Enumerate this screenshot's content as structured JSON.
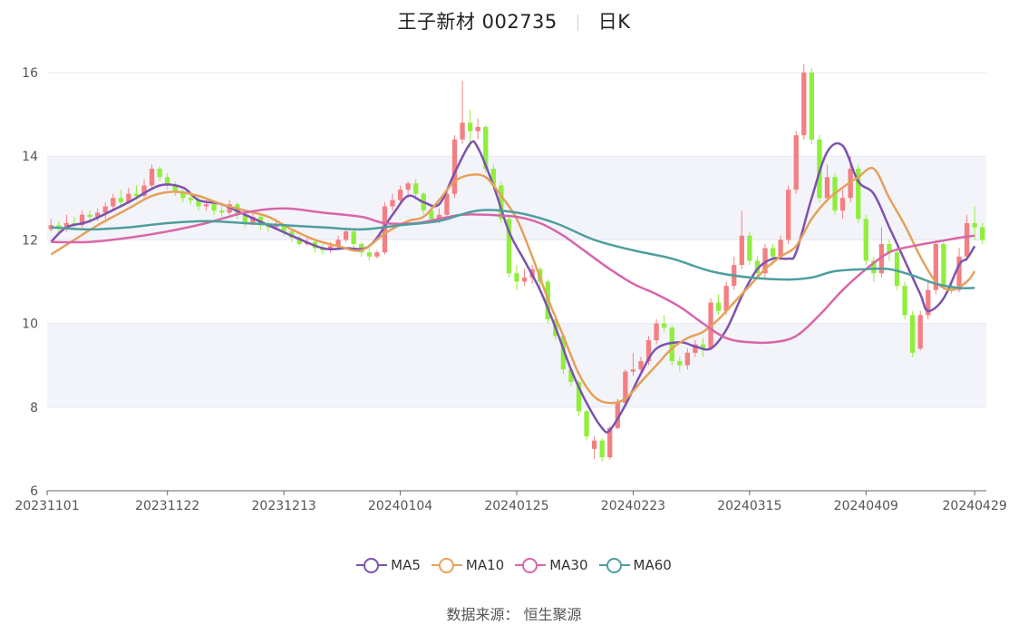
{
  "header": {
    "title": "王子新材 002735",
    "period": "日K"
  },
  "source": {
    "label": "数据来源：",
    "name": "恒生聚源"
  },
  "colors": {
    "up": "#f47f82",
    "down": "#90ee3c",
    "MA5": "#7b52b0",
    "MA10": "#e6a05a",
    "MA30": "#d966a8",
    "MA60": "#4f9e9e",
    "band": "#f3f4fa",
    "grid": "#e4e7f2"
  },
  "chart_data": {
    "type": "candlestick",
    "ylim": [
      6,
      16
    ],
    "y_ticks": [
      6,
      8,
      10,
      12,
      14,
      16
    ],
    "x_ticks": [
      "20231101",
      "20231122",
      "20231213",
      "20240104",
      "20240125",
      "20240223",
      "20240315",
      "20240409",
      "20240429"
    ],
    "x_tick_index": [
      0,
      15,
      30,
      45,
      60,
      75,
      90,
      105,
      119
    ],
    "legend": [
      "MA5",
      "MA10",
      "MA30",
      "MA60"
    ],
    "legend_position": "bottom",
    "grid": true,
    "candles": [
      [
        12.25,
        12.35,
        12.5,
        12.2
      ],
      [
        12.35,
        12.3,
        12.45,
        12.15
      ],
      [
        12.3,
        12.4,
        12.6,
        12.2
      ],
      [
        12.4,
        12.35,
        12.55,
        12.25
      ],
      [
        12.35,
        12.6,
        12.7,
        12.3
      ],
      [
        12.6,
        12.55,
        12.7,
        12.4
      ],
      [
        12.55,
        12.65,
        12.75,
        12.45
      ],
      [
        12.65,
        12.8,
        12.9,
        12.5
      ],
      [
        12.8,
        13.0,
        13.1,
        12.7
      ],
      [
        13.0,
        12.9,
        13.2,
        12.8
      ],
      [
        12.9,
        13.1,
        13.25,
        12.85
      ],
      [
        13.1,
        13.05,
        13.3,
        12.95
      ],
      [
        13.05,
        13.3,
        13.45,
        13.0
      ],
      [
        13.3,
        13.7,
        13.8,
        13.2
      ],
      [
        13.7,
        13.5,
        13.75,
        13.4
      ],
      [
        13.5,
        13.3,
        13.6,
        13.2
      ],
      [
        13.3,
        13.15,
        13.4,
        13.05
      ],
      [
        13.15,
        13.0,
        13.2,
        12.9
      ],
      [
        13.0,
        12.95,
        13.1,
        12.85
      ],
      [
        12.95,
        12.8,
        13.05,
        12.7
      ],
      [
        12.8,
        12.85,
        13.0,
        12.7
      ],
      [
        12.85,
        12.7,
        12.95,
        12.6
      ],
      [
        12.7,
        12.65,
        12.85,
        12.55
      ],
      [
        12.65,
        12.85,
        12.95,
        12.6
      ],
      [
        12.85,
        12.6,
        12.9,
        12.5
      ],
      [
        12.6,
        12.4,
        12.7,
        12.3
      ],
      [
        12.4,
        12.55,
        12.65,
        12.35
      ],
      [
        12.55,
        12.35,
        12.6,
        12.25
      ],
      [
        12.35,
        12.3,
        12.45,
        12.2
      ],
      [
        12.3,
        12.35,
        12.5,
        12.25
      ],
      [
        12.35,
        12.2,
        12.4,
        12.1
      ],
      [
        12.2,
        12.05,
        12.25,
        11.95
      ],
      [
        12.05,
        11.9,
        12.1,
        11.85
      ],
      [
        11.9,
        11.95,
        12.05,
        11.85
      ],
      [
        11.95,
        11.8,
        12.0,
        11.7
      ],
      [
        11.8,
        11.75,
        11.9,
        11.65
      ],
      [
        11.75,
        11.85,
        11.95,
        11.7
      ],
      [
        11.85,
        12.0,
        12.1,
        11.8
      ],
      [
        12.0,
        12.2,
        12.3,
        11.95
      ],
      [
        12.2,
        11.9,
        12.25,
        11.8
      ],
      [
        11.9,
        11.7,
        11.95,
        11.6
      ],
      [
        11.7,
        11.6,
        11.8,
        11.5
      ],
      [
        11.6,
        11.7,
        11.75,
        11.55
      ],
      [
        11.7,
        12.8,
        12.9,
        11.65
      ],
      [
        12.8,
        12.95,
        13.1,
        12.7
      ],
      [
        12.95,
        13.2,
        13.3,
        12.85
      ],
      [
        13.2,
        13.35,
        13.4,
        13.0
      ],
      [
        13.35,
        13.1,
        13.45,
        12.95
      ],
      [
        13.1,
        12.7,
        13.15,
        12.6
      ],
      [
        12.7,
        12.5,
        12.8,
        12.4
      ],
      [
        12.5,
        12.6,
        12.75,
        12.4
      ],
      [
        12.6,
        13.1,
        13.2,
        12.55
      ],
      [
        13.1,
        14.4,
        14.5,
        13.0
      ],
      [
        14.4,
        14.8,
        15.8,
        14.3
      ],
      [
        14.8,
        14.6,
        15.1,
        14.2
      ],
      [
        14.6,
        14.7,
        14.9,
        14.4
      ],
      [
        14.7,
        13.7,
        14.75,
        13.6
      ],
      [
        13.7,
        13.3,
        13.8,
        13.2
      ],
      [
        13.3,
        12.5,
        13.4,
        12.4
      ],
      [
        12.5,
        11.2,
        12.55,
        11.1
      ],
      [
        11.2,
        11.0,
        11.4,
        10.8
      ],
      [
        11.0,
        11.1,
        11.3,
        10.9
      ],
      [
        11.1,
        11.3,
        11.4,
        10.95
      ],
      [
        11.3,
        11.0,
        11.35,
        10.8
      ],
      [
        11.0,
        10.1,
        11.05,
        10.0
      ],
      [
        10.1,
        9.7,
        10.15,
        9.6
      ],
      [
        9.7,
        8.9,
        9.75,
        8.8
      ],
      [
        8.9,
        8.6,
        8.95,
        8.5
      ],
      [
        8.6,
        7.9,
        8.65,
        7.8
      ],
      [
        7.9,
        7.3,
        7.95,
        7.2
      ],
      [
        7.0,
        7.2,
        7.3,
        6.75
      ],
      [
        7.2,
        6.8,
        7.25,
        6.7
      ],
      [
        6.8,
        7.5,
        7.55,
        6.75
      ],
      [
        7.5,
        8.1,
        8.2,
        7.45
      ],
      [
        8.1,
        8.85,
        8.9,
        8.0
      ],
      [
        8.85,
        8.9,
        9.3,
        8.75
      ],
      [
        8.9,
        9.1,
        9.2,
        8.8
      ],
      [
        9.1,
        9.6,
        9.7,
        9.0
      ],
      [
        9.6,
        10.0,
        10.1,
        9.5
      ],
      [
        10.0,
        9.9,
        10.2,
        9.8
      ],
      [
        9.9,
        9.1,
        9.95,
        9.0
      ],
      [
        9.1,
        9.0,
        9.2,
        8.85
      ],
      [
        9.0,
        9.3,
        9.4,
        8.9
      ],
      [
        9.3,
        9.5,
        9.6,
        9.2
      ],
      [
        9.5,
        9.4,
        9.65,
        9.2
      ],
      [
        9.4,
        10.5,
        10.6,
        9.35
      ],
      [
        10.5,
        10.3,
        10.7,
        10.2
      ],
      [
        10.3,
        10.9,
        11.0,
        10.2
      ],
      [
        10.9,
        11.4,
        11.6,
        10.8
      ],
      [
        11.4,
        12.1,
        12.7,
        11.3
      ],
      [
        12.1,
        11.5,
        12.2,
        11.4
      ],
      [
        11.5,
        11.2,
        11.6,
        11.1
      ],
      [
        11.2,
        11.8,
        11.9,
        11.1
      ],
      [
        11.8,
        11.6,
        11.9,
        11.4
      ],
      [
        11.6,
        12.0,
        12.1,
        11.5
      ],
      [
        12.0,
        13.2,
        13.3,
        11.9
      ],
      [
        13.2,
        14.5,
        14.6,
        13.1
      ],
      [
        14.5,
        16.0,
        16.2,
        14.4
      ],
      [
        16.0,
        14.4,
        16.1,
        14.3
      ],
      [
        14.4,
        13.0,
        14.5,
        12.9
      ],
      [
        13.0,
        13.5,
        13.8,
        12.9
      ],
      [
        13.5,
        12.7,
        13.6,
        12.6
      ],
      [
        12.7,
        13.0,
        13.2,
        12.5
      ],
      [
        13.0,
        13.7,
        14.0,
        12.9
      ],
      [
        13.7,
        12.5,
        13.8,
        12.4
      ],
      [
        12.5,
        11.5,
        12.6,
        11.4
      ],
      [
        11.5,
        11.2,
        11.6,
        11.0
      ],
      [
        11.2,
        11.9,
        12.3,
        11.1
      ],
      [
        11.9,
        11.7,
        12.0,
        11.5
      ],
      [
        11.7,
        10.9,
        11.8,
        10.8
      ],
      [
        10.9,
        10.2,
        11.0,
        10.1
      ],
      [
        10.2,
        9.3,
        10.3,
        9.2
      ],
      [
        9.4,
        10.2,
        10.3,
        9.35
      ],
      [
        10.2,
        10.8,
        11.0,
        10.1
      ],
      [
        10.8,
        11.9,
        12.0,
        10.7
      ],
      [
        11.9,
        10.9,
        11.95,
        10.8
      ],
      [
        10.9,
        10.8,
        11.0,
        10.7
      ],
      [
        10.8,
        11.6,
        11.8,
        10.75
      ],
      [
        11.6,
        12.4,
        12.6,
        11.5
      ],
      [
        12.4,
        12.3,
        12.8,
        12.0
      ],
      [
        12.3,
        12.0,
        12.4,
        11.9
      ]
    ],
    "series": [
      {
        "name": "MA5",
        "values": [
          [
            0,
            11.95
          ],
          [
            2,
            12.3
          ],
          [
            5,
            12.45
          ],
          [
            10,
            12.9
          ],
          [
            14,
            13.3
          ],
          [
            17,
            13.25
          ],
          [
            19,
            12.95
          ],
          [
            22,
            12.85
          ],
          [
            25,
            12.6
          ],
          [
            28,
            12.35
          ],
          [
            31,
            12.1
          ],
          [
            35,
            11.8
          ],
          [
            38,
            11.8
          ],
          [
            41,
            11.85
          ],
          [
            44,
            12.6
          ],
          [
            46,
            13.05
          ],
          [
            48,
            12.9
          ],
          [
            50,
            12.85
          ],
          [
            52,
            13.6
          ],
          [
            54,
            14.3
          ],
          [
            55,
            14.2
          ],
          [
            57,
            13.3
          ],
          [
            59,
            12.2
          ],
          [
            61,
            11.5
          ],
          [
            63,
            10.8
          ],
          [
            65,
            9.9
          ],
          [
            67,
            8.9
          ],
          [
            69,
            8.1
          ],
          [
            71,
            7.5
          ],
          [
            72,
            7.45
          ],
          [
            74,
            8.05
          ],
          [
            76,
            8.8
          ],
          [
            78,
            9.4
          ],
          [
            81,
            9.55
          ],
          [
            83,
            9.45
          ],
          [
            85,
            9.4
          ],
          [
            87,
            9.85
          ],
          [
            89,
            10.65
          ],
          [
            91,
            11.3
          ],
          [
            93,
            11.55
          ],
          [
            95,
            11.55
          ],
          [
            96,
            11.7
          ],
          [
            98,
            13.0
          ],
          [
            100,
            14.1
          ],
          [
            102,
            14.25
          ],
          [
            104,
            13.4
          ],
          [
            106,
            13.1
          ],
          [
            108,
            12.3
          ],
          [
            110,
            11.5
          ],
          [
            112,
            10.7
          ],
          [
            113,
            10.3
          ],
          [
            115,
            10.6
          ],
          [
            117,
            11.4
          ],
          [
            118,
            11.55
          ],
          [
            119,
            11.85
          ]
        ]
      },
      {
        "name": "MA10",
        "values": [
          [
            0,
            11.65
          ],
          [
            3,
            12.0
          ],
          [
            6,
            12.35
          ],
          [
            10,
            12.75
          ],
          [
            13,
            13.05
          ],
          [
            16,
            13.15
          ],
          [
            19,
            13.05
          ],
          [
            22,
            12.85
          ],
          [
            25,
            12.7
          ],
          [
            28,
            12.55
          ],
          [
            31,
            12.25
          ],
          [
            34,
            12.0
          ],
          [
            37,
            11.85
          ],
          [
            40,
            11.75
          ],
          [
            43,
            12.15
          ],
          [
            46,
            12.45
          ],
          [
            48,
            12.55
          ],
          [
            50,
            12.95
          ],
          [
            52,
            13.4
          ],
          [
            54,
            13.55
          ],
          [
            56,
            13.5
          ],
          [
            58,
            13.05
          ],
          [
            60,
            12.5
          ],
          [
            62,
            11.6
          ],
          [
            64,
            10.6
          ],
          [
            66,
            9.7
          ],
          [
            68,
            8.8
          ],
          [
            70,
            8.25
          ],
          [
            72,
            8.1
          ],
          [
            74,
            8.2
          ],
          [
            76,
            8.6
          ],
          [
            78,
            9.0
          ],
          [
            80,
            9.4
          ],
          [
            82,
            9.65
          ],
          [
            84,
            9.8
          ],
          [
            86,
            10.1
          ],
          [
            88,
            10.5
          ],
          [
            90,
            10.9
          ],
          [
            92,
            11.3
          ],
          [
            94,
            11.6
          ],
          [
            96,
            11.85
          ],
          [
            98,
            12.5
          ],
          [
            100,
            12.95
          ],
          [
            102,
            13.25
          ],
          [
            104,
            13.5
          ],
          [
            106,
            13.7
          ],
          [
            108,
            13.0
          ],
          [
            110,
            12.35
          ],
          [
            112,
            11.6
          ],
          [
            114,
            11.0
          ],
          [
            116,
            10.8
          ],
          [
            118,
            11.0
          ],
          [
            119,
            11.25
          ]
        ]
      },
      {
        "name": "MA30",
        "values": [
          [
            0,
            11.95
          ],
          [
            5,
            11.95
          ],
          [
            10,
            12.05
          ],
          [
            15,
            12.2
          ],
          [
            20,
            12.4
          ],
          [
            25,
            12.65
          ],
          [
            30,
            12.75
          ],
          [
            35,
            12.65
          ],
          [
            40,
            12.55
          ],
          [
            43,
            12.4
          ],
          [
            47,
            12.4
          ],
          [
            50,
            12.5
          ],
          [
            53,
            12.6
          ],
          [
            56,
            12.6
          ],
          [
            60,
            12.55
          ],
          [
            63,
            12.4
          ],
          [
            66,
            12.1
          ],
          [
            69,
            11.7
          ],
          [
            72,
            11.3
          ],
          [
            75,
            10.95
          ],
          [
            78,
            10.7
          ],
          [
            81,
            10.4
          ],
          [
            84,
            10.0
          ],
          [
            87,
            9.65
          ],
          [
            90,
            9.55
          ],
          [
            93,
            9.55
          ],
          [
            96,
            9.7
          ],
          [
            99,
            10.2
          ],
          [
            102,
            10.8
          ],
          [
            105,
            11.3
          ],
          [
            108,
            11.7
          ],
          [
            111,
            11.85
          ],
          [
            114,
            11.95
          ],
          [
            117,
            12.05
          ],
          [
            119,
            12.1
          ]
        ]
      },
      {
        "name": "MA60",
        "values": [
          [
            0,
            12.3
          ],
          [
            5,
            12.25
          ],
          [
            10,
            12.3
          ],
          [
            15,
            12.4
          ],
          [
            20,
            12.45
          ],
          [
            25,
            12.4
          ],
          [
            30,
            12.35
          ],
          [
            35,
            12.3
          ],
          [
            40,
            12.25
          ],
          [
            45,
            12.35
          ],
          [
            50,
            12.45
          ],
          [
            55,
            12.7
          ],
          [
            60,
            12.65
          ],
          [
            65,
            12.4
          ],
          [
            70,
            12.0
          ],
          [
            75,
            11.75
          ],
          [
            80,
            11.55
          ],
          [
            85,
            11.25
          ],
          [
            90,
            11.1
          ],
          [
            95,
            11.05
          ],
          [
            98,
            11.1
          ],
          [
            101,
            11.25
          ],
          [
            105,
            11.3
          ],
          [
            108,
            11.3
          ],
          [
            111,
            11.15
          ],
          [
            114,
            10.95
          ],
          [
            117,
            10.85
          ],
          [
            119,
            10.85
          ]
        ]
      }
    ]
  }
}
